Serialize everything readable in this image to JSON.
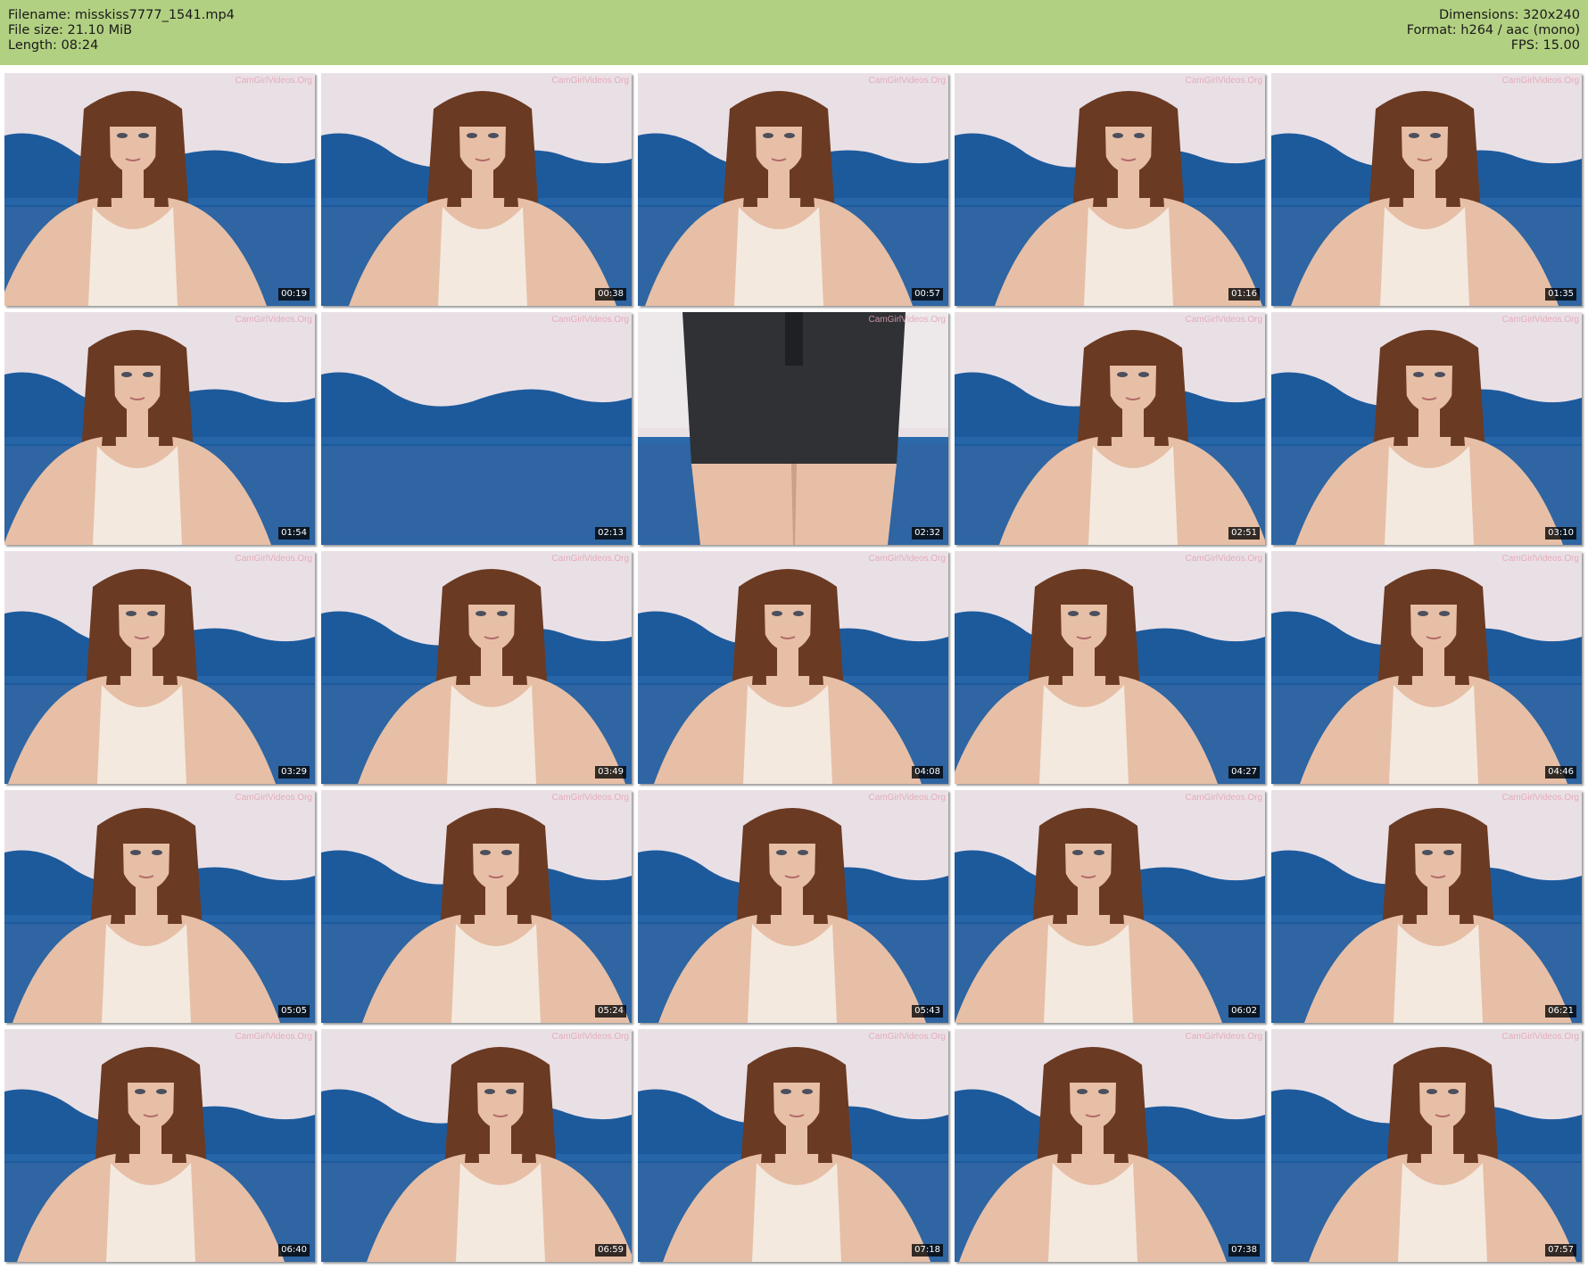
{
  "header": {
    "filename_line": "Filename: misskiss7777_1541.mp4",
    "filesize_line": "File size: 21.10 MiB",
    "length_line": "Length: 08:24",
    "dimensions_line": "Dimensions: 320x240",
    "format_line": "Format: h264 / aac (mono)",
    "fps_line": "FPS: 15.00"
  },
  "colors": {
    "header_bg": "#b2d082",
    "wall": "#e9e0e6",
    "sofa": "#1d5a9c",
    "hair": "#6b3a22",
    "skin": "#e7bfa6",
    "top": "#f3e9df",
    "watermark": "#e5a3b2"
  },
  "watermark": "CamGirlVideos.Org",
  "thumbnails": [
    {
      "time": "00:19",
      "scene": "person"
    },
    {
      "time": "00:38",
      "scene": "person"
    },
    {
      "time": "00:57",
      "scene": "person"
    },
    {
      "time": "01:16",
      "scene": "person"
    },
    {
      "time": "01:35",
      "scene": "person"
    },
    {
      "time": "01:54",
      "scene": "person"
    },
    {
      "time": "02:13",
      "scene": "empty"
    },
    {
      "time": "02:32",
      "scene": "skirt"
    },
    {
      "time": "02:51",
      "scene": "person"
    },
    {
      "time": "03:10",
      "scene": "person"
    },
    {
      "time": "03:29",
      "scene": "person"
    },
    {
      "time": "03:49",
      "scene": "person"
    },
    {
      "time": "04:08",
      "scene": "person"
    },
    {
      "time": "04:27",
      "scene": "person"
    },
    {
      "time": "04:46",
      "scene": "person"
    },
    {
      "time": "05:05",
      "scene": "person"
    },
    {
      "time": "05:24",
      "scene": "person"
    },
    {
      "time": "05:43",
      "scene": "person"
    },
    {
      "time": "06:02",
      "scene": "person"
    },
    {
      "time": "06:21",
      "scene": "person"
    },
    {
      "time": "06:40",
      "scene": "person"
    },
    {
      "time": "06:59",
      "scene": "person"
    },
    {
      "time": "07:18",
      "scene": "person"
    },
    {
      "time": "07:38",
      "scene": "person"
    },
    {
      "time": "07:57",
      "scene": "person"
    }
  ]
}
